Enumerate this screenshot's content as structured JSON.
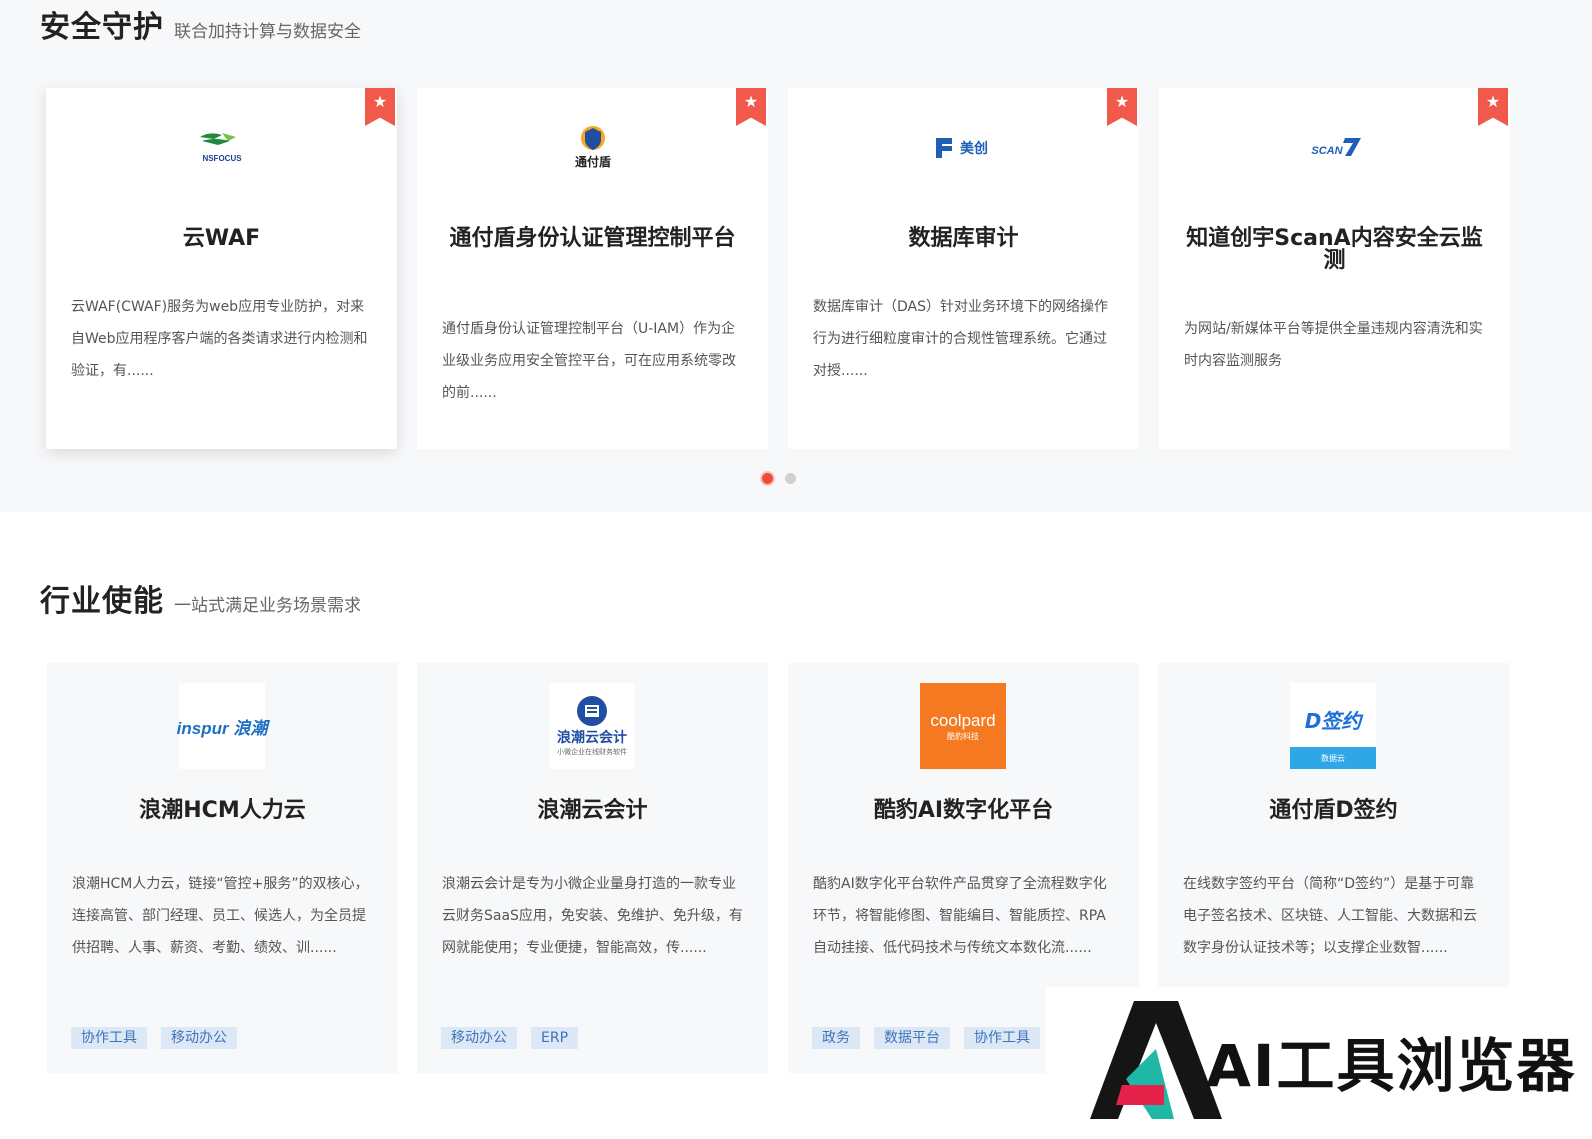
{
  "security": {
    "title": "安全守护",
    "subtitle": "联合加持计算与数据安全",
    "cards": [
      {
        "logo": "NSFOCUS",
        "title": "云WAF",
        "desc": "云WAF(CWAF)服务为web应用专业防护，对来自Web应用程序客户端的各类请求进行内检测和验证，有......"
      },
      {
        "logo": "通付盾",
        "title": "通付盾身份认证管理控制平台",
        "desc": "通付盾身份认证管理控制平台（U-IAM）作为企业级业务应用安全管控平台，可在应用系统零改的前......"
      },
      {
        "logo": "美创",
        "title": "数据库审计",
        "desc": "数据库审计（DAS）针对业务环境下的网络操作行为进行细粒度审计的合规性管理系统。它通过对授......"
      },
      {
        "logo": "SCAN",
        "title": "知道创宇ScanA内容安全云监测",
        "desc": "为网站/新媒体平台等提供全量违规内容清洗和实时内容监测服务"
      }
    ]
  },
  "industry": {
    "title": "行业使能",
    "subtitle": "一站式满足业务场景需求",
    "cards": [
      {
        "logo": "inspur 浪潮",
        "title": "浪潮HCM人力云",
        "desc": "浪潮HCM人力云，链接“管控+服务”的双核心，连接高管、部门经理、员工、候选人，为全员提供招聘、人事、薪资、考勤、绩效、训......",
        "tags": [
          "协作工具",
          "移动办公"
        ]
      },
      {
        "logo": "浪潮云会计",
        "logo_sub": "小微企业在线财务软件",
        "title": "浪潮云会计",
        "desc": "浪潮云会计是专为小微企业量身打造的一款专业云财务SaaS应用，免安装、免维护、免升级，有网就能使用；专业便捷，智能高效，传......",
        "tags": [
          "移动办公",
          "ERP"
        ]
      },
      {
        "logo": "coolpard",
        "logo_sub": "酷豹科技",
        "title": "酷豹AI数字化平台",
        "desc": "酷豹AI数字化平台软件产品贯穿了全流程数字化环节，将智能修图、智能编目、智能质控、RPA自动挂接、低代码技术与传统文本数化流......",
        "tags": [
          "政务",
          "数据平台",
          "协作工具"
        ]
      },
      {
        "logo": "D签约",
        "logo_sub": "数据云",
        "title": "通付盾D签约",
        "desc": "在线数字签约平台（简称“D签约”）是基于可靠电子签名技术、区块链、人工智能、大数据和云数字身份认证技术等；以支撑企业数智......",
        "tags": []
      }
    ]
  },
  "watermark": {
    "text": "AI工具浏览器"
  },
  "colors": {
    "accent": "#f15a4a",
    "tag_bg": "#dde8f7",
    "tag_text": "#3f73b8",
    "coolpard": "#f47920",
    "nsfocus": "#1f8a3b",
    "scan": "#1e5fb8"
  }
}
